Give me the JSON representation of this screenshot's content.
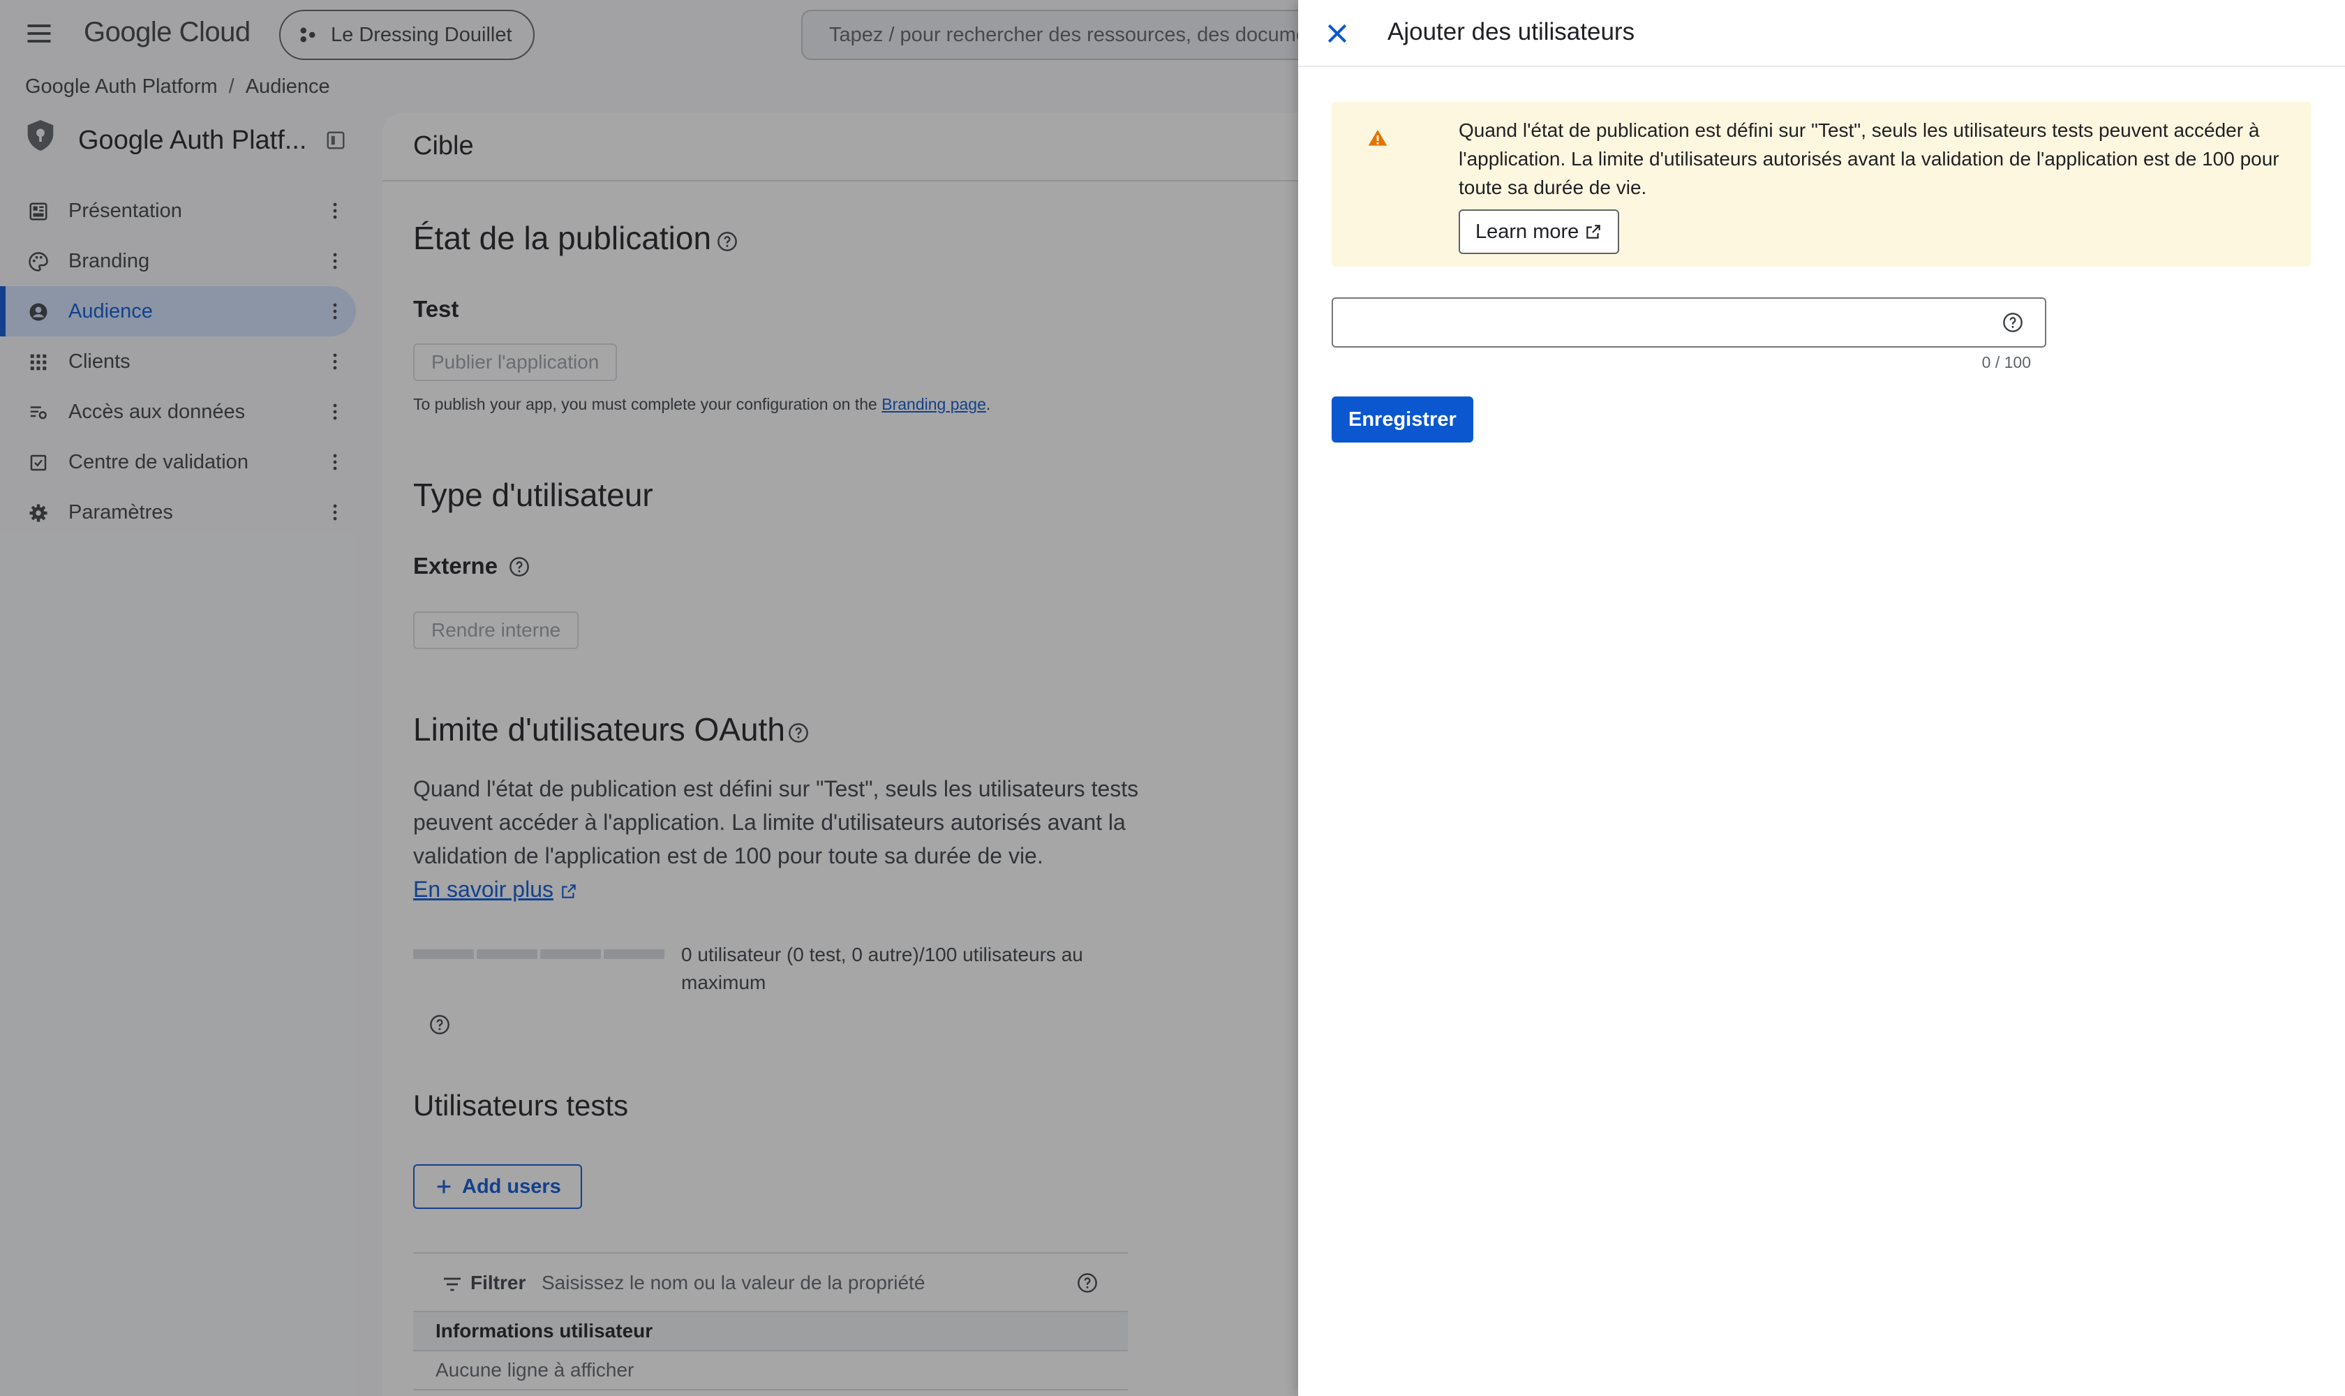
{
  "topbar": {
    "logo": "Google Cloud",
    "project": "Le Dressing Douillet",
    "search_placeholder": "Tapez / pour rechercher des ressources, des documen"
  },
  "breadcrumb": [
    "Google Auth Platform",
    "/",
    "Audience"
  ],
  "product": {
    "title": "Google Auth Platf..."
  },
  "sidebar": {
    "items": [
      {
        "label": "Présentation",
        "icon": "dashboard-icon"
      },
      {
        "label": "Branding",
        "icon": "palette-icon"
      },
      {
        "label": "Audience",
        "icon": "account-circle-icon",
        "active": true
      },
      {
        "label": "Clients",
        "icon": "apps-grid-icon"
      },
      {
        "label": "Accès aux données",
        "icon": "data-access-icon"
      },
      {
        "label": "Centre de validation",
        "icon": "verification-icon"
      },
      {
        "label": "Paramètres",
        "icon": "gear-icon"
      }
    ]
  },
  "main": {
    "card_title": "Cible",
    "publishing": {
      "heading": "État de la publication",
      "status": "Test",
      "publish_button": "Publier l'application",
      "note_prefix": "To publish your app, you must complete your configuration on the ",
      "note_link": "Branding page",
      "note_suffix": "."
    },
    "user_type": {
      "heading": "Type d'utilisateur",
      "value": "Externe",
      "button": "Rendre interne"
    },
    "oauth_limit": {
      "heading": "Limite d'utilisateurs OAuth",
      "paragraph": "Quand l'état de publication est défini sur \"Test\", seuls les utilisateurs tests peuvent accéder à l'application. La limite d'utilisateurs autorisés avant la validation de l'application est de 100 pour toute sa durée de vie.",
      "link": "En savoir plus",
      "usage_label": "0 utilisateur (0 test, 0 autre)/100 utilisateurs au maximum",
      "usage_fraction": 0
    },
    "test_users": {
      "heading": "Utilisateurs tests",
      "add_button": "Add users",
      "filter_label": "Filtrer",
      "filter_placeholder": "Saisissez le nom ou la valeur de la propriété",
      "column_header": "Informations utilisateur",
      "empty_text": "Aucune ligne à afficher"
    }
  },
  "panel": {
    "title": "Ajouter des utilisateurs",
    "alert_text": "Quand l'état de publication est défini sur \"Test\", seuls les utilisateurs tests peuvent accéder à l'application. La limite d'utilisateurs autorisés avant la validation de l'application est de 100 pour toute sa durée de vie.",
    "learn_more": "Learn more",
    "input_value": "",
    "counter": "0 / 100",
    "save_button": "Enregistrer"
  },
  "colors": {
    "accent": "#0b57d0",
    "warning": "#e37400",
    "alert_bg": "#fef7e0"
  }
}
